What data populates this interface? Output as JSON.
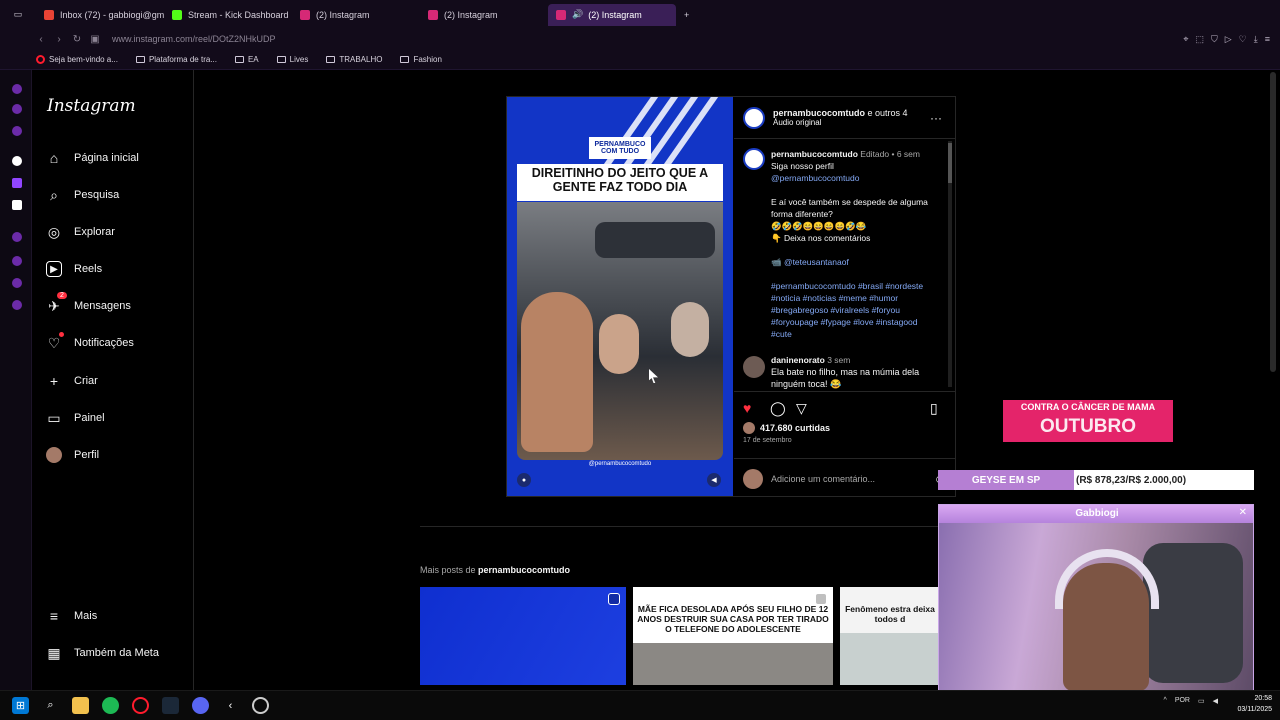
{
  "browser": {
    "tabs": [
      {
        "label": "Inbox (72) - gabbiogi@gm",
        "color": "#ea4335"
      },
      {
        "label": "Stream - Kick Dashboard",
        "color": "#53fc18"
      },
      {
        "label": "(2) Instagram",
        "color": "#d62976"
      },
      {
        "label": "(2) Instagram",
        "color": "#d62976"
      },
      {
        "label": "(2) Instagram",
        "color": "#d62976"
      }
    ],
    "url": "www.instagram.com/reel/DOtZ2NHkUDP",
    "bookmarks": [
      "Seja bem-vindo a...",
      "Plataforma de tra...",
      "EA",
      "Lives",
      "TRABALHO",
      "Fashion"
    ]
  },
  "sidebar": {
    "logo": "Instagram",
    "items": [
      {
        "label": "Página inicial",
        "icon": "⌂"
      },
      {
        "label": "Pesquisa",
        "icon": "⌕"
      },
      {
        "label": "Explorar",
        "icon": "◎"
      },
      {
        "label": "Reels",
        "icon": "▶"
      },
      {
        "label": "Mensagens",
        "icon": "✈",
        "badge": "2"
      },
      {
        "label": "Notificações",
        "icon": "♡"
      },
      {
        "label": "Criar",
        "icon": "+"
      },
      {
        "label": "Painel",
        "icon": "▭"
      },
      {
        "label": "Perfil",
        "icon": ""
      }
    ],
    "more": "Mais",
    "meta": "Também da Meta"
  },
  "post": {
    "media": {
      "brand": "PERNAMBUCO COM TUDO",
      "headline": "DIREITINHO DO JEITO QUE A GENTE FAZ TODO DIA",
      "handle": "@pernambucocomtudo"
    },
    "header": {
      "author": "pernambucocomtudo",
      "others": "e outros 4",
      "audio": "Áudio original"
    },
    "caption": {
      "author": "pernambucocomtudo",
      "edited": "Editado •",
      "time": "6 sem",
      "line1": "Siga nosso perfil",
      "mention": "@pernambucocomtudo",
      "line2": "E aí você também se despede de alguma forma diferente?",
      "emojis": "🤣🤣🤣😄😄😄😄🤣😂",
      "cta": "👇 Deixa nos comentários",
      "credit": "📹 @teteusantanaof",
      "hashtags": "#pernambucocomtudo #brasil #nordeste #noticia #noticias #meme #humor #bregabregoso #viralreels #foryou #foryoupage #fypage #love #instagood #cute"
    },
    "comment": {
      "author": "daninenorato",
      "time": "3 sem",
      "text": "Ela bate no filho, mas na múmia dela ninguém toca! 😂"
    },
    "likes": "417.680 curtidas",
    "date": "17 de setembro",
    "add_comment_placeholder": "Adicione um comentário..."
  },
  "more_posts": {
    "prefix": "Mais posts de",
    "author": "pernambucocomtudo",
    "thumb2": "MÃE FICA DESOLADA APÓS SEU FILHO DE 12 ANOS DESTRUIR SUA CASA POR TER TIRADO O TELEFONE DO ADOLESCENTE",
    "thumb3": "Fenômeno estra deixa todos d"
  },
  "overlay": {
    "banner_top": "CONTRA O CÂNCER DE MAMA",
    "banner_big": "OUTUBRO",
    "goal_label": "GEYSE EM SP",
    "goal_amount": "(R$ 878,23/R$ 2.000,00)",
    "goal_progress": 0.44,
    "cam_title": "Gabbiogi"
  },
  "system": {
    "lang": "POR",
    "time": "20:58",
    "date": "03/11/2025"
  }
}
